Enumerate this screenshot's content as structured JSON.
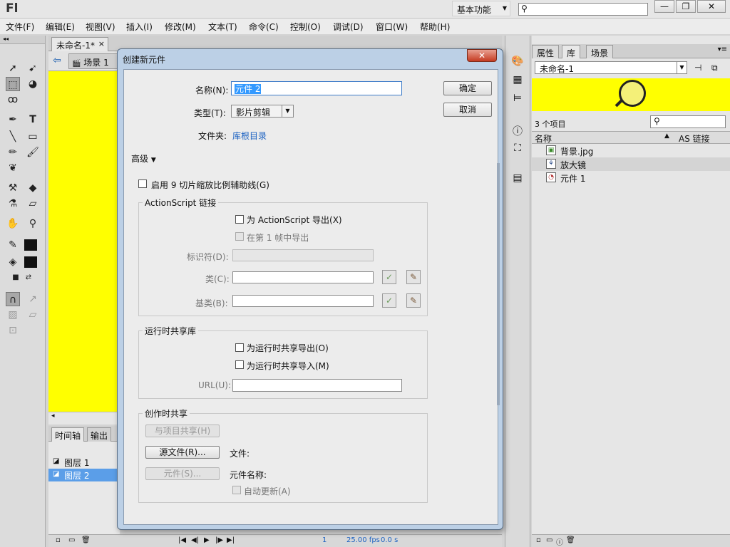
{
  "app": {
    "logo": "Fl",
    "workspace": "基本功能",
    "window_buttons": [
      "—",
      "❐",
      "✕"
    ]
  },
  "menu": [
    "文件(F)",
    "编辑(E)",
    "视图(V)",
    "插入(I)",
    "修改(M)",
    "文本(T)",
    "命令(C)",
    "控制(O)",
    "调试(D)",
    "窗口(W)",
    "帮助(H)"
  ],
  "document": {
    "tab": "未命名-1*",
    "tab_close": "×",
    "scene": "场景 1",
    "stage_color": "#ffff00"
  },
  "timeline": {
    "tabs": [
      "时间轴",
      "输出"
    ],
    "layers": [
      "图层 1",
      "图层 2"
    ],
    "selected_layer": 1,
    "frame": "1",
    "fps": "25.00 fps",
    "time": "0.0 s"
  },
  "library": {
    "tabs": [
      "属性",
      "库",
      "场景"
    ],
    "active_tab": 1,
    "doc_select": "未命名-1",
    "count": "3 个项目",
    "col_name": "名称",
    "col_link": "AS 链接",
    "items": [
      {
        "name": "背景.jpg",
        "icon": "bitmap-icon"
      },
      {
        "name": "放大镜",
        "icon": "movieclip-icon"
      },
      {
        "name": "元件 1",
        "icon": "graphic-icon"
      }
    ],
    "selected_item": 1
  },
  "dialog": {
    "title": "创建新元件",
    "close": "✕",
    "name_label": "名称(N):",
    "name_value": "元件 2",
    "type_label": "类型(T):",
    "type_value": "影片剪辑",
    "folder_label": "文件夹:",
    "folder_value": "库根目录",
    "ok": "确定",
    "cancel": "取消",
    "advanced": "高级",
    "advanced_arrow": "▼",
    "nine_slice": "启用 9 切片缩放比例辅助线(G)",
    "as_group": "ActionScript 链接",
    "export_as": "为 ActionScript 导出(X)",
    "export_frame1": "在第 1 帧中导出",
    "identifier_label": "标识符(D):",
    "class_label": "类(C):",
    "base_class_label": "基类(B):",
    "rsl_group": "运行时共享库",
    "rsl_export": "为运行时共享导出(O)",
    "rsl_import": "为运行时共享导入(M)",
    "url_label": "URL(U):",
    "author_group": "创作时共享",
    "share_project": "与项目共享(H)",
    "source_file": "源文件(R)...",
    "file_label": "文件:",
    "symbol_btn": "元件(S)...",
    "symbol_name_label": "元件名称:",
    "auto_update": "自动更新(A)"
  }
}
